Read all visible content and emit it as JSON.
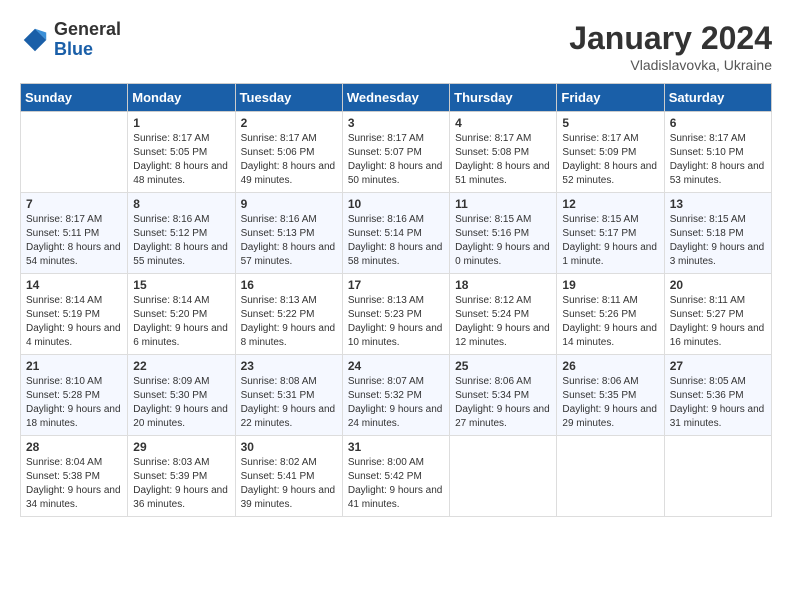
{
  "logo": {
    "general": "General",
    "blue": "Blue"
  },
  "title": "January 2024",
  "location": "Vladislavovka, Ukraine",
  "weekdays": [
    "Sunday",
    "Monday",
    "Tuesday",
    "Wednesday",
    "Thursday",
    "Friday",
    "Saturday"
  ],
  "weeks": [
    [
      {
        "day": "",
        "sunrise": "",
        "sunset": "",
        "daylight": ""
      },
      {
        "day": "1",
        "sunrise": "Sunrise: 8:17 AM",
        "sunset": "Sunset: 5:05 PM",
        "daylight": "Daylight: 8 hours and 48 minutes."
      },
      {
        "day": "2",
        "sunrise": "Sunrise: 8:17 AM",
        "sunset": "Sunset: 5:06 PM",
        "daylight": "Daylight: 8 hours and 49 minutes."
      },
      {
        "day": "3",
        "sunrise": "Sunrise: 8:17 AM",
        "sunset": "Sunset: 5:07 PM",
        "daylight": "Daylight: 8 hours and 50 minutes."
      },
      {
        "day": "4",
        "sunrise": "Sunrise: 8:17 AM",
        "sunset": "Sunset: 5:08 PM",
        "daylight": "Daylight: 8 hours and 51 minutes."
      },
      {
        "day": "5",
        "sunrise": "Sunrise: 8:17 AM",
        "sunset": "Sunset: 5:09 PM",
        "daylight": "Daylight: 8 hours and 52 minutes."
      },
      {
        "day": "6",
        "sunrise": "Sunrise: 8:17 AM",
        "sunset": "Sunset: 5:10 PM",
        "daylight": "Daylight: 8 hours and 53 minutes."
      }
    ],
    [
      {
        "day": "7",
        "sunrise": "Sunrise: 8:17 AM",
        "sunset": "Sunset: 5:11 PM",
        "daylight": "Daylight: 8 hours and 54 minutes."
      },
      {
        "day": "8",
        "sunrise": "Sunrise: 8:16 AM",
        "sunset": "Sunset: 5:12 PM",
        "daylight": "Daylight: 8 hours and 55 minutes."
      },
      {
        "day": "9",
        "sunrise": "Sunrise: 8:16 AM",
        "sunset": "Sunset: 5:13 PM",
        "daylight": "Daylight: 8 hours and 57 minutes."
      },
      {
        "day": "10",
        "sunrise": "Sunrise: 8:16 AM",
        "sunset": "Sunset: 5:14 PM",
        "daylight": "Daylight: 8 hours and 58 minutes."
      },
      {
        "day": "11",
        "sunrise": "Sunrise: 8:15 AM",
        "sunset": "Sunset: 5:16 PM",
        "daylight": "Daylight: 9 hours and 0 minutes."
      },
      {
        "day": "12",
        "sunrise": "Sunrise: 8:15 AM",
        "sunset": "Sunset: 5:17 PM",
        "daylight": "Daylight: 9 hours and 1 minute."
      },
      {
        "day": "13",
        "sunrise": "Sunrise: 8:15 AM",
        "sunset": "Sunset: 5:18 PM",
        "daylight": "Daylight: 9 hours and 3 minutes."
      }
    ],
    [
      {
        "day": "14",
        "sunrise": "Sunrise: 8:14 AM",
        "sunset": "Sunset: 5:19 PM",
        "daylight": "Daylight: 9 hours and 4 minutes."
      },
      {
        "day": "15",
        "sunrise": "Sunrise: 8:14 AM",
        "sunset": "Sunset: 5:20 PM",
        "daylight": "Daylight: 9 hours and 6 minutes."
      },
      {
        "day": "16",
        "sunrise": "Sunrise: 8:13 AM",
        "sunset": "Sunset: 5:22 PM",
        "daylight": "Daylight: 9 hours and 8 minutes."
      },
      {
        "day": "17",
        "sunrise": "Sunrise: 8:13 AM",
        "sunset": "Sunset: 5:23 PM",
        "daylight": "Daylight: 9 hours and 10 minutes."
      },
      {
        "day": "18",
        "sunrise": "Sunrise: 8:12 AM",
        "sunset": "Sunset: 5:24 PM",
        "daylight": "Daylight: 9 hours and 12 minutes."
      },
      {
        "day": "19",
        "sunrise": "Sunrise: 8:11 AM",
        "sunset": "Sunset: 5:26 PM",
        "daylight": "Daylight: 9 hours and 14 minutes."
      },
      {
        "day": "20",
        "sunrise": "Sunrise: 8:11 AM",
        "sunset": "Sunset: 5:27 PM",
        "daylight": "Daylight: 9 hours and 16 minutes."
      }
    ],
    [
      {
        "day": "21",
        "sunrise": "Sunrise: 8:10 AM",
        "sunset": "Sunset: 5:28 PM",
        "daylight": "Daylight: 9 hours and 18 minutes."
      },
      {
        "day": "22",
        "sunrise": "Sunrise: 8:09 AM",
        "sunset": "Sunset: 5:30 PM",
        "daylight": "Daylight: 9 hours and 20 minutes."
      },
      {
        "day": "23",
        "sunrise": "Sunrise: 8:08 AM",
        "sunset": "Sunset: 5:31 PM",
        "daylight": "Daylight: 9 hours and 22 minutes."
      },
      {
        "day": "24",
        "sunrise": "Sunrise: 8:07 AM",
        "sunset": "Sunset: 5:32 PM",
        "daylight": "Daylight: 9 hours and 24 minutes."
      },
      {
        "day": "25",
        "sunrise": "Sunrise: 8:06 AM",
        "sunset": "Sunset: 5:34 PM",
        "daylight": "Daylight: 9 hours and 27 minutes."
      },
      {
        "day": "26",
        "sunrise": "Sunrise: 8:06 AM",
        "sunset": "Sunset: 5:35 PM",
        "daylight": "Daylight: 9 hours and 29 minutes."
      },
      {
        "day": "27",
        "sunrise": "Sunrise: 8:05 AM",
        "sunset": "Sunset: 5:36 PM",
        "daylight": "Daylight: 9 hours and 31 minutes."
      }
    ],
    [
      {
        "day": "28",
        "sunrise": "Sunrise: 8:04 AM",
        "sunset": "Sunset: 5:38 PM",
        "daylight": "Daylight: 9 hours and 34 minutes."
      },
      {
        "day": "29",
        "sunrise": "Sunrise: 8:03 AM",
        "sunset": "Sunset: 5:39 PM",
        "daylight": "Daylight: 9 hours and 36 minutes."
      },
      {
        "day": "30",
        "sunrise": "Sunrise: 8:02 AM",
        "sunset": "Sunset: 5:41 PM",
        "daylight": "Daylight: 9 hours and 39 minutes."
      },
      {
        "day": "31",
        "sunrise": "Sunrise: 8:00 AM",
        "sunset": "Sunset: 5:42 PM",
        "daylight": "Daylight: 9 hours and 41 minutes."
      },
      {
        "day": "",
        "sunrise": "",
        "sunset": "",
        "daylight": ""
      },
      {
        "day": "",
        "sunrise": "",
        "sunset": "",
        "daylight": ""
      },
      {
        "day": "",
        "sunrise": "",
        "sunset": "",
        "daylight": ""
      }
    ]
  ]
}
